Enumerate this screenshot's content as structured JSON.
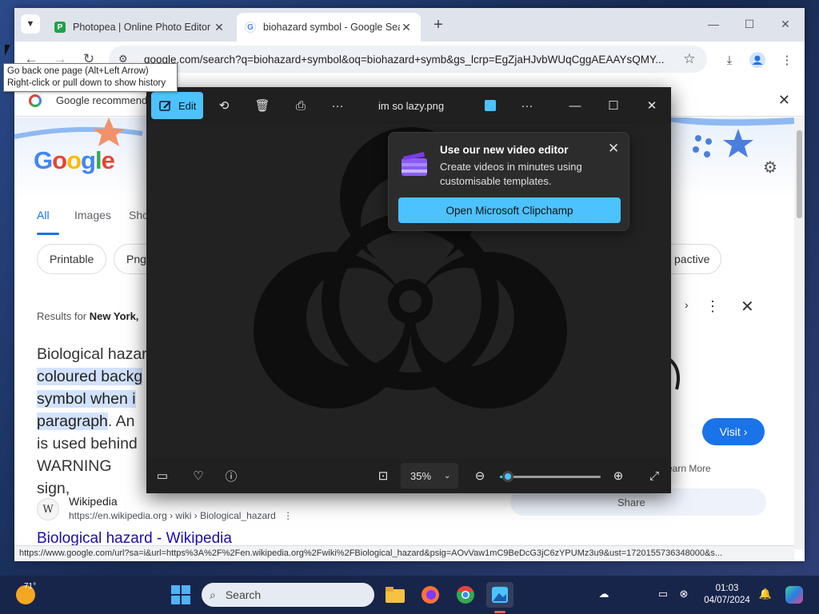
{
  "browser": {
    "tabs": [
      {
        "title": "Photopea | Online Photo Editor",
        "favicon_color": "#1ea34a"
      },
      {
        "title": "biohazard symbol - Google Search",
        "favicon_color": "#4285f4"
      }
    ],
    "url": "google.com/search?q=biohazard+symbol&oq=biohazard+symb&gs_lcrp=EgZjaHJvbWUqCggAEAAYsQMY...",
    "tooltip": [
      "Go back one page (Alt+Left Arrow)",
      "Right-click or pull down to show history"
    ],
    "infobar_text": "Google recommend",
    "status_url": "https://www.google.com/url?sa=i&url=https%3A%2F%2Fen.wikipedia.org%2Fwiki%2FBiological_hazard&psig=AOvVaw1mC9BeDcG3jC6zYPUMz3u9&ust=1720155736348000&s..."
  },
  "google": {
    "logo": "Google",
    "tabs": [
      "All",
      "Images",
      "Sho"
    ],
    "chips": [
      "Printable",
      "Png",
      "pactive"
    ],
    "results_for_prefix": "Results for ",
    "results_for_location": "New York,",
    "snippet": {
      "plain1": "Biological hazar",
      "hl1": "coloured backg",
      "hl2": "symbol when i",
      "hl3": "paragraph",
      "plain2": ". An",
      "plain3": "is used behind",
      "plain4": "WARNING sign,"
    },
    "result": {
      "site": "Wikipedia",
      "url": "https://en.wikipedia.org › wiki › Biological_hazard",
      "title": "Biological hazard - Wikipedia"
    },
    "side": {
      "visit": "Visit",
      "learn_more": "earn More",
      "share": "Share"
    }
  },
  "photos": {
    "edit_label": "Edit",
    "file_name": "im so lazy.png",
    "zoom": "35%",
    "zoom_slider_fraction": 0.08,
    "teaching": {
      "title": "Use our new video editor",
      "body": "Create videos in minutes using customisable templates.",
      "button": "Open Microsoft Clipchamp"
    }
  },
  "taskbar": {
    "temperature": "71°",
    "search_placeholder": "Search",
    "time": "01:03",
    "date": "04/07/2024"
  },
  "colors": {
    "accent": "#4cc2ff",
    "link": "#1a0dab",
    "google_blue": "#1a73e8"
  }
}
